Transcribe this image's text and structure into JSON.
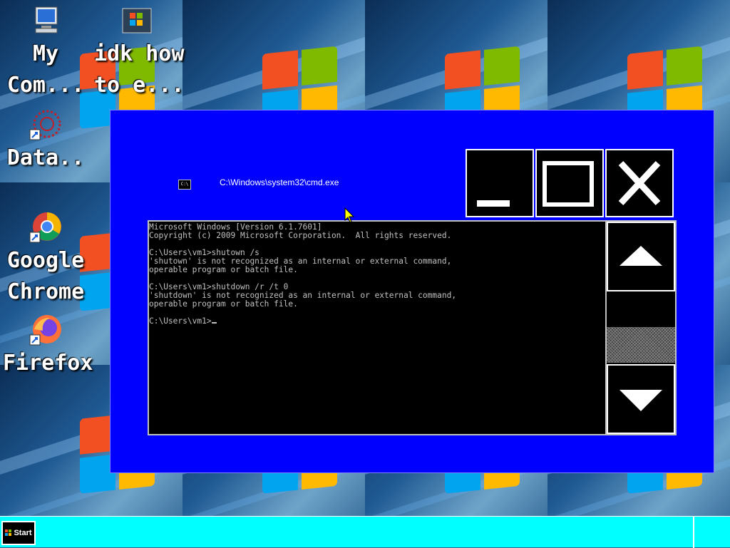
{
  "desktop": {
    "icons": [
      {
        "label": "My\nCom...",
        "name": "my-computer"
      },
      {
        "label": "idk how\nto e...",
        "name": "idk-how"
      },
      {
        "label": "Data..",
        "name": "data"
      },
      {
        "label": "Google\nChrome",
        "name": "google-chrome"
      },
      {
        "label": "Firefox",
        "name": "firefox"
      }
    ],
    "partial_right_label": "e"
  },
  "window": {
    "title": "C:\\Windows\\system32\\cmd.exe",
    "icon_text": "C:\\",
    "console_text": "Microsoft Windows [Version 6.1.7601]\nCopyright (c) 2009 Microsoft Corporation.  All rights reserved.\n\nC:\\Users\\vm1>shutown /s\n'shutown' is not recognized as an internal or external command,\noperable program or batch file.\n\nC:\\Users\\vm1>shutdown /r /t 0\n'shutdown' is not recognized as an internal or external command,\noperable program or batch file.\n\nC:\\Users\\vm1>",
    "scroll_position": 1.0
  },
  "taskbar": {
    "start_label": "Start"
  },
  "colors": {
    "window_bg": "#0000ff",
    "taskbar_bg": "#00ffff",
    "console_text": "#c0c0c0"
  }
}
